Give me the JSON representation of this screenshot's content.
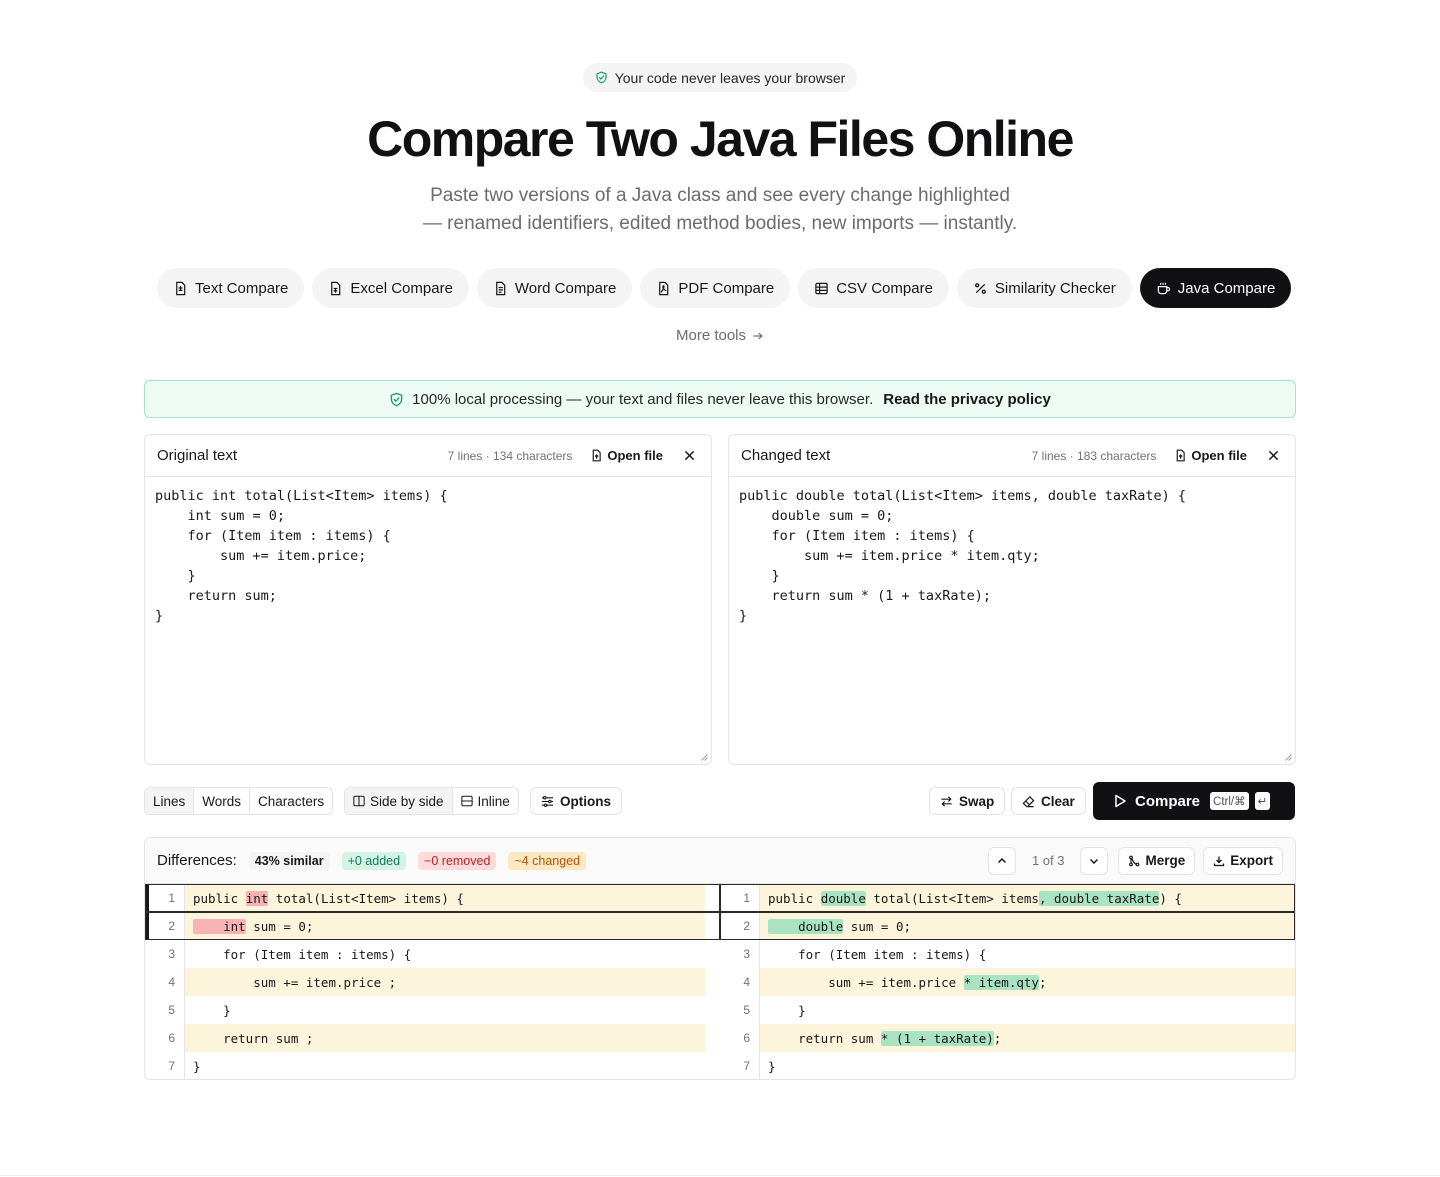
{
  "hero": {
    "badge": "Your code never leaves your browser",
    "title": "Compare Two Java Files Online",
    "subtitle_line1": "Paste two versions of a Java class and see every change highlighted",
    "subtitle_line2": "— renamed identifiers, edited method bodies, new imports — instantly."
  },
  "tools": [
    {
      "label": "Text Compare",
      "icon": "file-text-icon"
    },
    {
      "label": "Excel Compare",
      "icon": "file-sheet-icon"
    },
    {
      "label": "Word Compare",
      "icon": "file-doc-icon"
    },
    {
      "label": "PDF Compare",
      "icon": "file-pdf-icon"
    },
    {
      "label": "CSV Compare",
      "icon": "table-icon"
    },
    {
      "label": "Similarity Checker",
      "icon": "percent-icon"
    },
    {
      "label": "Java Compare",
      "icon": "coffee-icon",
      "active": true
    }
  ],
  "more_tools": "More tools",
  "privacy": {
    "text": "100% local processing — your text and files never leave this browser.",
    "link": "Read the privacy policy"
  },
  "original": {
    "title": "Original text",
    "stats": "7 lines · 134 characters",
    "open_file": "Open file",
    "content": "public int total(List<Item> items) {\n    int sum = 0;\n    for (Item item : items) {\n        sum += item.price;\n    }\n    return sum;\n}"
  },
  "changed": {
    "title": "Changed text",
    "stats": "7 lines · 183 characters",
    "open_file": "Open file",
    "content": "public double total(List<Item> items, double taxRate) {\n    double sum = 0;\n    for (Item item : items) {\n        sum += item.price * item.qty;\n    }\n    return sum * (1 + taxRate);\n}"
  },
  "toolbar": {
    "granularity": [
      "Lines",
      "Words",
      "Characters"
    ],
    "view": [
      "Side by side",
      "Inline"
    ],
    "options": "Options",
    "swap": "Swap",
    "clear": "Clear",
    "compare": "Compare",
    "shortcut_mod": "Ctrl/⌘",
    "shortcut_key": "↵"
  },
  "results": {
    "label": "Differences:",
    "similar": "43% similar",
    "added": "+0 added",
    "removed": "−0 removed",
    "changed": "~4 changed",
    "position": "1 of 3",
    "merge": "Merge",
    "export": "Export"
  },
  "colors": {
    "accent_dark": "#111113",
    "removed_hl": "#f8b4b4",
    "added_hl": "#a9e3c2",
    "changed_row": "#fdf4dc",
    "privacy_bg": "#eefaf4"
  },
  "diff": {
    "left": [
      {
        "n": "1",
        "kind": "chg",
        "focus": true,
        "parts": [
          [
            "",
            "public "
          ],
          [
            "rmv",
            "int"
          ],
          [
            "",
            " total(List<Item> items) {"
          ]
        ]
      },
      {
        "n": "2",
        "kind": "chg",
        "focus": true,
        "parts": [
          [
            "rmv",
            "    int"
          ],
          [
            "",
            " sum = 0;"
          ]
        ]
      },
      {
        "n": "3",
        "kind": "same",
        "parts": [
          [
            "",
            "    for (Item item : items) {"
          ]
        ]
      },
      {
        "n": "4",
        "kind": "chg",
        "parts": [
          [
            "",
            "        sum += item.price ;"
          ]
        ]
      },
      {
        "n": "5",
        "kind": "same",
        "parts": [
          [
            "",
            "    }"
          ]
        ]
      },
      {
        "n": "6",
        "kind": "chg",
        "parts": [
          [
            "",
            "    return sum ;"
          ]
        ]
      },
      {
        "n": "7",
        "kind": "same",
        "parts": [
          [
            "",
            "}"
          ]
        ]
      }
    ],
    "right": [
      {
        "n": "1",
        "kind": "chg",
        "focus": true,
        "parts": [
          [
            "",
            "public "
          ],
          [
            "ins",
            "double"
          ],
          [
            "",
            " total(List<Item> items"
          ],
          [
            "ins",
            ", double taxRate"
          ],
          [
            "",
            ") {"
          ]
        ]
      },
      {
        "n": "2",
        "kind": "chg",
        "focus": true,
        "parts": [
          [
            "ins",
            "    double"
          ],
          [
            "",
            " sum = 0;"
          ]
        ]
      },
      {
        "n": "3",
        "kind": "same",
        "parts": [
          [
            "",
            "    for (Item item : items) {"
          ]
        ]
      },
      {
        "n": "4",
        "kind": "chg",
        "parts": [
          [
            "",
            "        sum += item.price "
          ],
          [
            "ins",
            "* item.qty"
          ],
          [
            "",
            ";"
          ]
        ]
      },
      {
        "n": "5",
        "kind": "same",
        "parts": [
          [
            "",
            "    }"
          ]
        ]
      },
      {
        "n": "6",
        "kind": "chg",
        "parts": [
          [
            "",
            "    return sum "
          ],
          [
            "ins",
            "* (1 + taxRate)"
          ],
          [
            "",
            ";"
          ]
        ]
      },
      {
        "n": "7",
        "kind": "same",
        "parts": [
          [
            "",
            "}"
          ]
        ]
      }
    ]
  }
}
